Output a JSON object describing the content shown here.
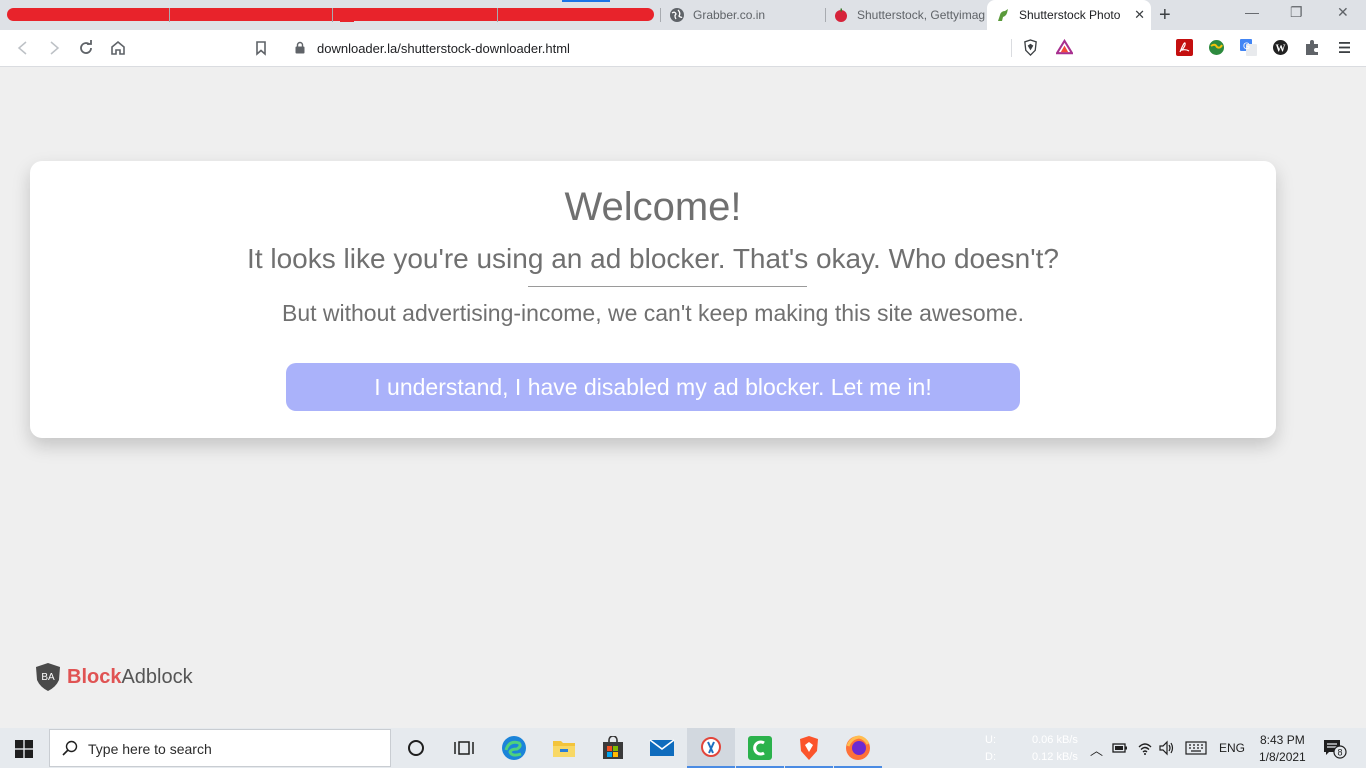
{
  "browser": {
    "tabs": [
      {
        "title": "Grabber.co.in",
        "favicon": "globe-icon",
        "active": false
      },
      {
        "title": "Shutterstock, Gettyimag",
        "favicon": "apple-icon",
        "active": false
      },
      {
        "title": "Shutterstock Photo",
        "favicon": "dinosaur-icon",
        "active": true
      }
    ],
    "url": "downloader.la/shutterstock-downloader.html"
  },
  "page": {
    "welcome": "Welcome!",
    "line1": "It looks like you're using an ad blocker. That's okay. Who doesn't?",
    "line2": "But without advertising-income, we can't keep making this site awesome.",
    "cta": "I understand, I have disabled my ad blocker. Let me in!",
    "brand": {
      "badge": "BA",
      "part1": "Block",
      "part2": "Adblock"
    }
  },
  "taskbar": {
    "search_placeholder": "Type here to search",
    "net_up_label": "U:",
    "net_down_label": "D:",
    "net_up": "0.06 kB/s",
    "net_down": "0.12 kB/s",
    "lang": "ENG",
    "time": "8:43 PM",
    "date": "1/8/2021",
    "notification_count": "8"
  },
  "colors": {
    "accent_button": "#aab2fa",
    "brand_red": "#e05353",
    "redaction": "#e8232b"
  }
}
